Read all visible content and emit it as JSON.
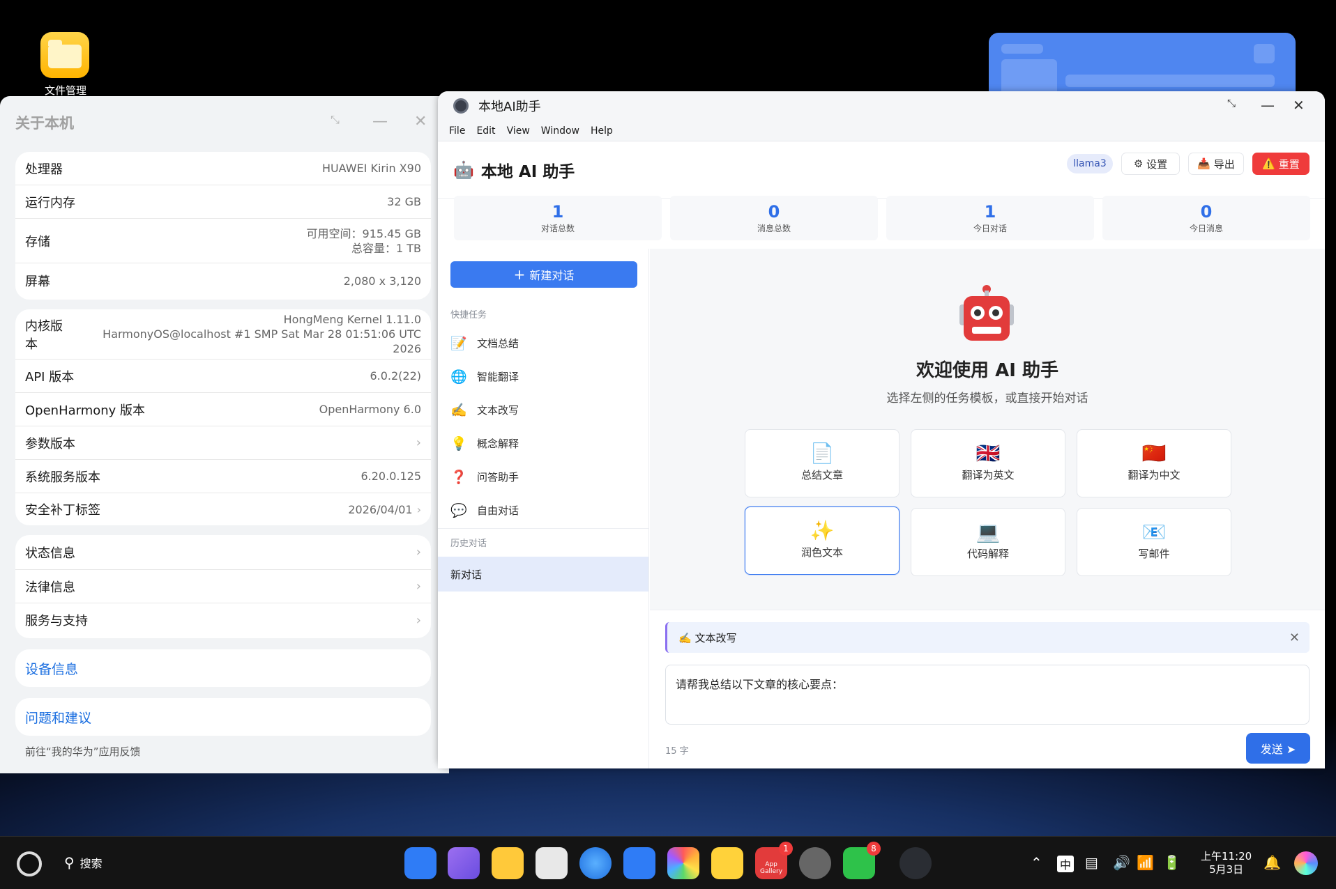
{
  "desktop": {
    "file_manager_label": "文件管理"
  },
  "about": {
    "title": "关于本机",
    "hw": [
      {
        "label": "处理器",
        "value": "HUAWEI Kirin X90"
      },
      {
        "label": "运行内存",
        "value": "32 GB"
      }
    ],
    "storage": {
      "label": "存储",
      "free": "可用空间：915.45 GB",
      "total": "总容量：1 TB"
    },
    "screen": {
      "label": "屏幕",
      "value": "2,080 x 3,120"
    },
    "kernel": {
      "label": "内核版本",
      "line1": "HongMeng Kernel 1.11.0",
      "line2": "HarmonyOS@localhost #1 SMP Sat Mar 28 01:51:06 UTC 2026"
    },
    "api": {
      "label": "API 版本",
      "value": "6.0.2(22)"
    },
    "openharmony": {
      "label": "OpenHarmony 版本",
      "value": "OpenHarmony 6.0"
    },
    "param": {
      "label": "参数版本"
    },
    "sysservice": {
      "label": "系统服务版本",
      "value": "6.20.0.125"
    },
    "patch": {
      "label": "安全补丁标签",
      "value": "2026/04/01"
    },
    "links": [
      "状态信息",
      "法律信息",
      "服务与支持"
    ],
    "device_info": "设备信息",
    "feedback": "问题和建议",
    "feedback_hint": "前往“我的华为”应用反馈"
  },
  "ai": {
    "window_title": "本地AI助手",
    "menu": [
      "File",
      "Edit",
      "View",
      "Window",
      "Help"
    ],
    "app_title": "本地 AI 助手",
    "model": "llama3",
    "settings": "设置",
    "export": "导出",
    "reset": "重置",
    "stats": [
      {
        "value": "1",
        "label": "对话总数"
      },
      {
        "value": "0",
        "label": "消息总数"
      },
      {
        "value": "1",
        "label": "今日对话"
      },
      {
        "value": "0",
        "label": "今日消息"
      }
    ],
    "new_chat": "新建对话",
    "quick_title": "快捷任务",
    "tasks": [
      {
        "icon": "📝",
        "label": "文档总结"
      },
      {
        "icon": "🌐",
        "label": "智能翻译"
      },
      {
        "icon": "✍️",
        "label": "文本改写"
      },
      {
        "icon": "💡",
        "label": "概念解释"
      },
      {
        "icon": "❓",
        "label": "问答助手"
      },
      {
        "icon": "💬",
        "label": "自由对话"
      }
    ],
    "history_title": "历史对话",
    "history": [
      "新对话"
    ],
    "welcome_title": "欢迎使用 AI 助手",
    "welcome_sub": "选择左侧的任务模板，或直接开始对话",
    "templates": [
      {
        "icon": "📄",
        "label": "总结文章"
      },
      {
        "icon": "🇬🇧",
        "label": "翻译为英文"
      },
      {
        "icon": "🇨🇳",
        "label": "翻译为中文"
      },
      {
        "icon": "✨",
        "label": "润色文本"
      },
      {
        "icon": "💻",
        "label": "代码解释"
      },
      {
        "icon": "📧",
        "label": "写邮件"
      }
    ],
    "active_tag": "✍️ 文本改写",
    "input_text": "请帮我总结以下文章的核心要点：",
    "char_count": "15 字",
    "send": "发送 ➤"
  },
  "taskbar": {
    "search": "搜索",
    "time": "上午11:20",
    "date": "5月3日",
    "ime": "中",
    "appgallery_badge": "1",
    "wechat_badge": "8",
    "appgallery_text": "App Gallery"
  }
}
